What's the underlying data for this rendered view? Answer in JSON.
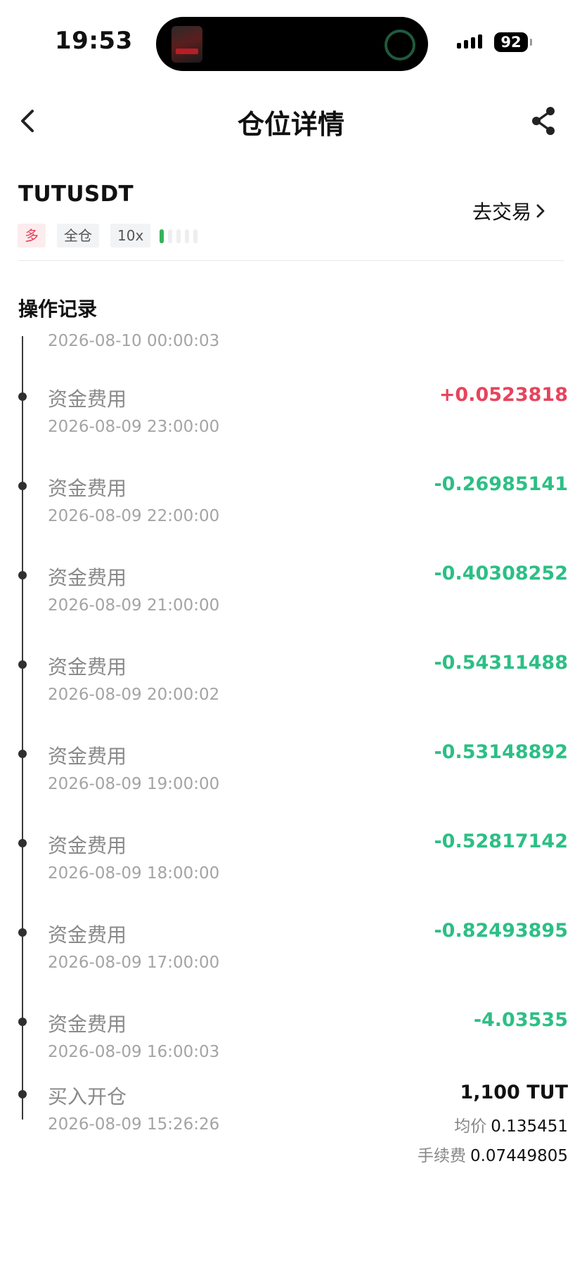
{
  "status_bar": {
    "time": "19:53",
    "battery": "92"
  },
  "nav": {
    "title": "仓位详情"
  },
  "position": {
    "symbol": "TUTUSDT",
    "direction_tag": "多",
    "margin_mode_tag": "全仓",
    "leverage_tag": "10x",
    "trade_link": "去交易"
  },
  "records_section": {
    "title": "操作记录",
    "partial_top_time": "2026-08-10 00:00:03",
    "items": [
      {
        "label": "资金费用",
        "time": "2026-08-09 23:00:00",
        "amount": "+0.0523818"
      },
      {
        "label": "资金费用",
        "time": "2026-08-09 22:00:00",
        "amount": "-0.26985141"
      },
      {
        "label": "资金费用",
        "time": "2026-08-09 21:00:00",
        "amount": "-0.40308252"
      },
      {
        "label": "资金费用",
        "time": "2026-08-09 20:00:02",
        "amount": "-0.54311488"
      },
      {
        "label": "资金费用",
        "time": "2026-08-09 19:00:00",
        "amount": "-0.53148892"
      },
      {
        "label": "资金费用",
        "time": "2026-08-09 18:00:00",
        "amount": "-0.52817142"
      },
      {
        "label": "资金费用",
        "time": "2026-08-09 17:00:00",
        "amount": "-0.82493895"
      },
      {
        "label": "资金费用",
        "time": "2026-08-09 16:00:03",
        "amount": "-4.03535"
      }
    ],
    "open_record": {
      "label": "买入开仓",
      "time": "2026-08-09 15:26:26",
      "quantity": "1,100 TUT",
      "avg_price_label": "均价",
      "avg_price": "0.135451",
      "fee_label": "手续费",
      "fee": "0.07449805"
    }
  },
  "colors": {
    "positive": "#e7445d",
    "negative": "#2cbf85",
    "risk_active": "#36b25b"
  },
  "icons": {
    "back": "chevron-left-icon",
    "share": "share-icon",
    "trade_arrow": "chevron-right-icon"
  }
}
